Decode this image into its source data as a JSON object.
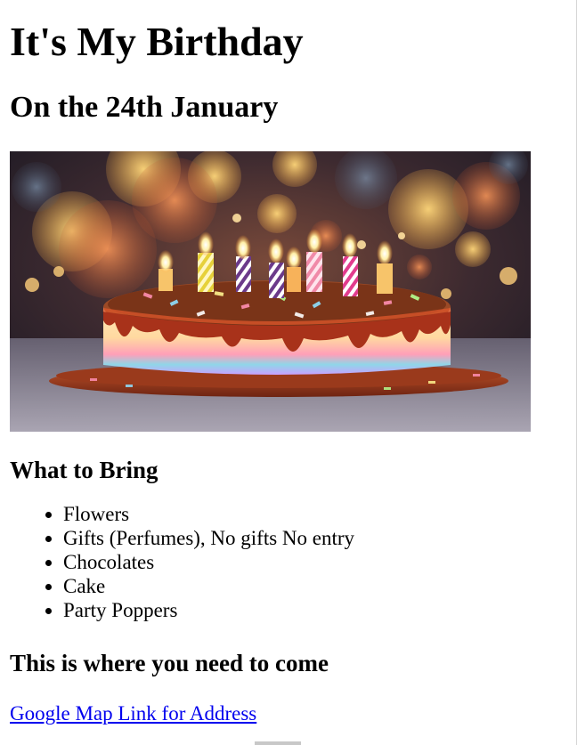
{
  "page": {
    "title": "It's My Birthday",
    "date": "On the 24th January"
  },
  "image": {
    "icon": "birthday-cake-photo"
  },
  "bring": {
    "heading": "What to Bring",
    "items": [
      "Flowers",
      "Gifts (Perfumes), No gifts No entry",
      "Chocolates",
      "Cake",
      "Party Poppers"
    ]
  },
  "location": {
    "heading": "This is where you need to come",
    "link_text": "Google Map Link for Address"
  },
  "colors": {
    "link": "#0000ee",
    "text": "#000000"
  }
}
